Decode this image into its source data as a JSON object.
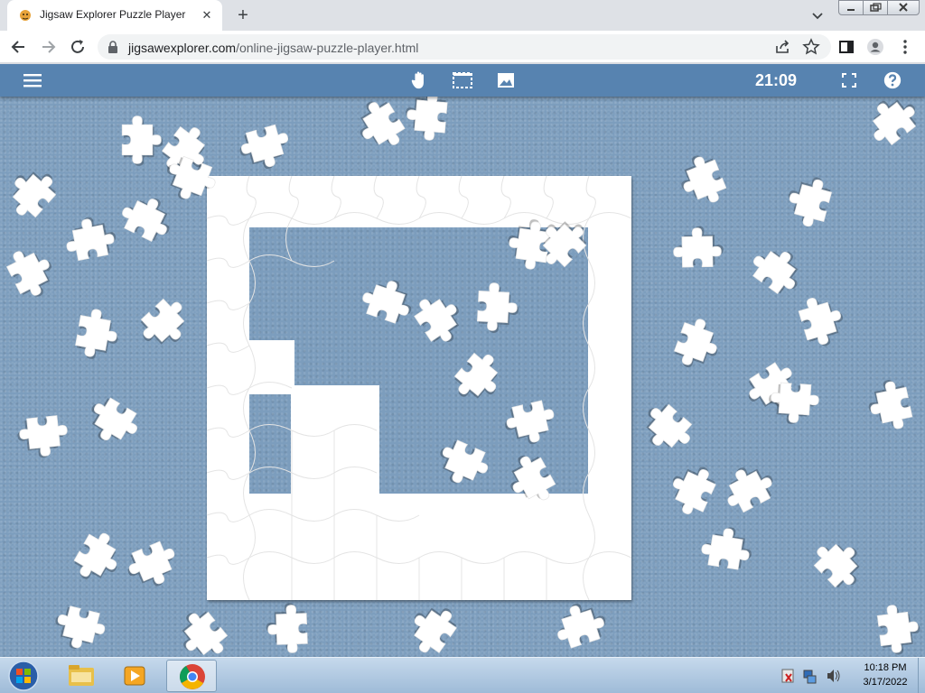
{
  "browser": {
    "tab": {
      "title": "Jigsaw Explorer Puzzle Player",
      "favicon": "puzzle-tiger-icon"
    },
    "omnibox": {
      "domain": "jigsawexplorer.com",
      "path": "/online-jigsaw-puzzle-player.html"
    }
  },
  "app": {
    "menu_icon": "hamburger-icon",
    "tools": [
      "pan-hand-icon",
      "select-region-icon",
      "image-preview-icon"
    ],
    "timer": "21:09",
    "fullscreen_icon": "fullscreen-icon",
    "help_icon": "help-icon"
  },
  "colors": {
    "appbar": "#5783b0",
    "table": "#7c9dbd",
    "piece": "#ffffff"
  },
  "taskbar": {
    "apps": [
      "file-explorer-icon",
      "media-player-icon",
      "chrome-icon"
    ],
    "tray_icons": [
      "action-center-icon",
      "network-icon",
      "volume-icon"
    ],
    "clock_time": "10:18 PM",
    "clock_date": "3/17/2022"
  }
}
